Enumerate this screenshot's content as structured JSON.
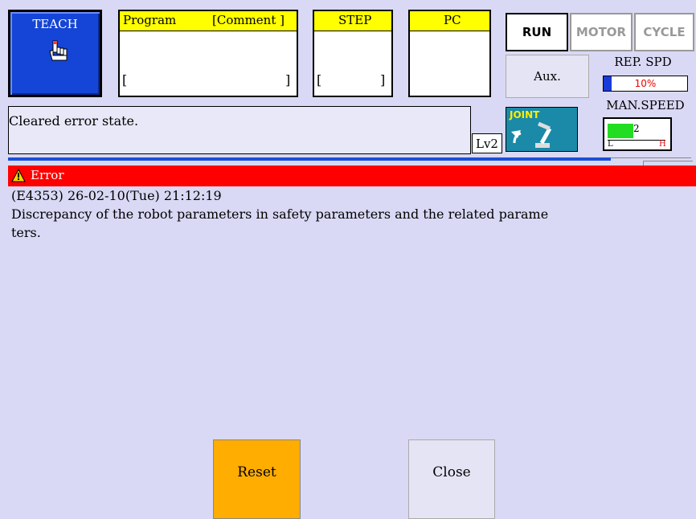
{
  "teach": {
    "label": "TEACH"
  },
  "program": {
    "label": "Program",
    "comment_label": "[Comment ]",
    "value": "",
    "bracket_open": "[",
    "bracket_close": "]"
  },
  "step": {
    "label": "STEP",
    "bracket_open": "[",
    "bracket_close": "]"
  },
  "pc": {
    "label": "PC"
  },
  "status_buttons": {
    "run": "RUN",
    "motor": "MOTOR",
    "cycle": "CYCLE",
    "aux": "Aux."
  },
  "rep_speed": {
    "label": "REP. SPD",
    "value_text": "10%",
    "fraction": 0.1
  },
  "man_speed": {
    "label": "MAN.SPEED",
    "level": "2",
    "low": "L",
    "high": "H"
  },
  "message": {
    "text": "Cleared error state.",
    "level": "Lv2"
  },
  "joint": {
    "label": "JOINT"
  },
  "error": {
    "title": "Error",
    "code_line": "(E4353) 26-02-10(Tue) 21:12:19",
    "line1": "Discrepancy of the robot parameters in safety parameters and the related parame",
    "line2": "ters."
  },
  "buttons": {
    "reset": "Reset",
    "close": "Close"
  },
  "colors": {
    "teach_bg": "#1545d6",
    "error_red": "#ff0000",
    "reset_orange": "#ffad00",
    "header_yellow": "#ffff00"
  }
}
